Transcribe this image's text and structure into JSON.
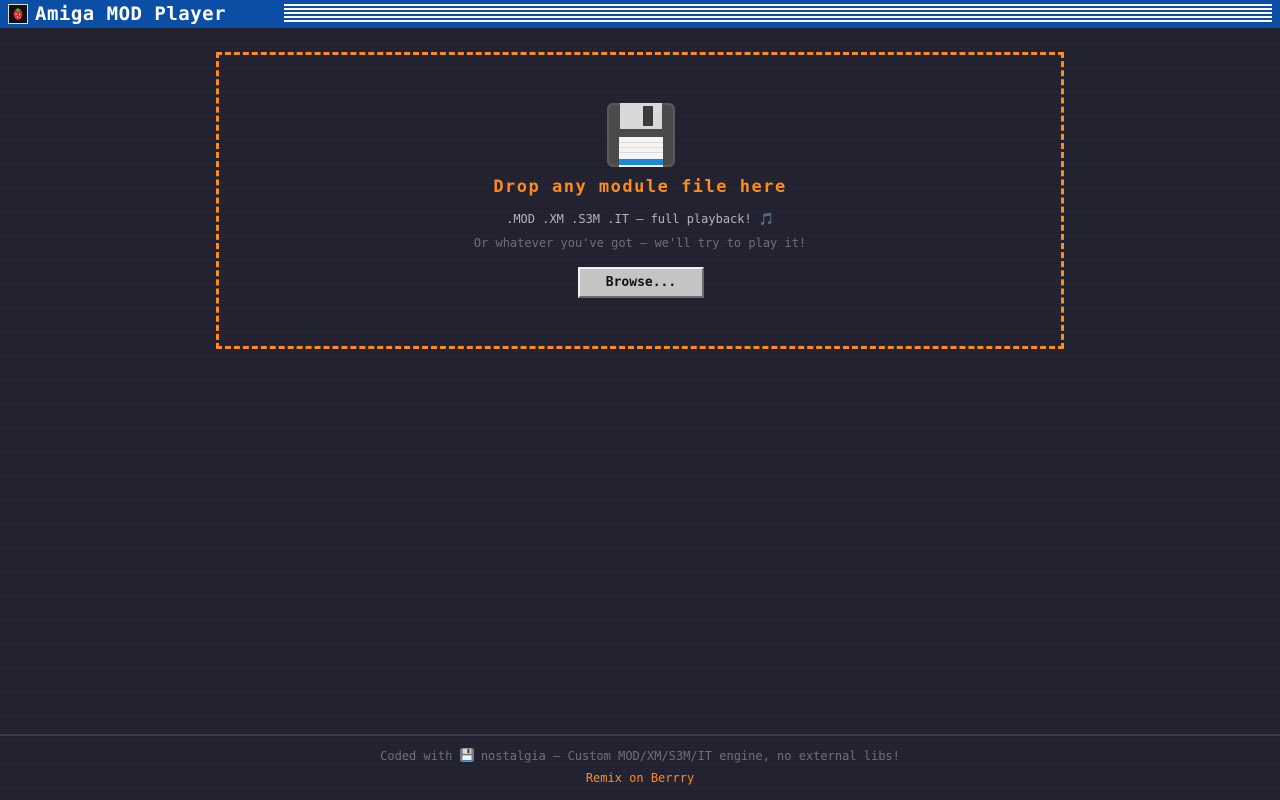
{
  "window": {
    "title": "Amiga MOD Player",
    "icon": "strawberry-icon"
  },
  "dropzone": {
    "icon": "floppy-disk-icon",
    "title": "Drop any module file here",
    "formats": ".MOD .XM .S3M .IT — full playback! 🎵",
    "hint": "Or whatever you've got — we'll try to play it!",
    "browse_label": "Browse..."
  },
  "footer": {
    "text_before": "Coded with ",
    "text_after": " nostalgia — Custom MOD/XM/S3M/IT engine, no external libs!",
    "link_label": "Remix on Berrry"
  },
  "colors": {
    "background": "#21212f",
    "titlebar": "#0a4ea6",
    "accent": "#ff8c1a",
    "button": "#c4c4c4"
  }
}
